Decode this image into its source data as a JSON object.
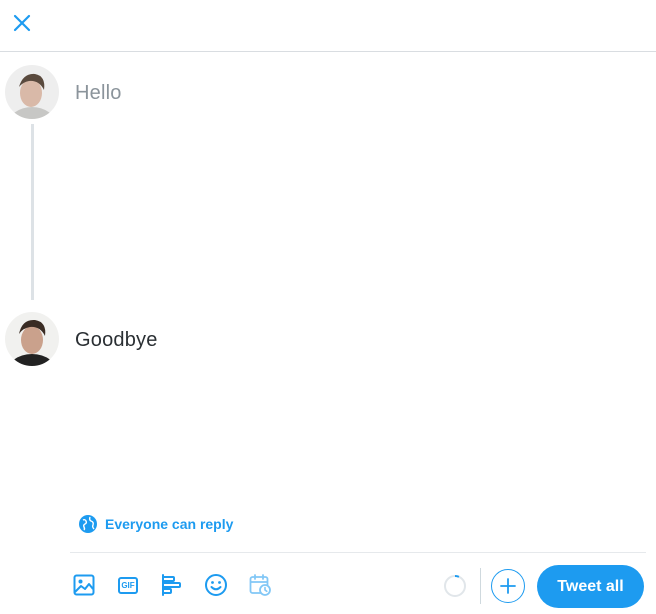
{
  "colors": {
    "accent": "#1d9bf0",
    "text_placeholder": "#8b949b",
    "text_primary": "#2a2f33"
  },
  "header": {
    "close_icon": "close-icon"
  },
  "thread": {
    "tweets": [
      {
        "text": "Hello",
        "state": "placeholder"
      },
      {
        "text": "Goodbye",
        "state": "filled"
      }
    ]
  },
  "reply_setting": {
    "icon": "globe-icon",
    "label": "Everyone can reply"
  },
  "toolbar": {
    "icons": [
      "image-icon",
      "gif-icon",
      "poll-icon",
      "emoji-icon",
      "schedule-icon"
    ],
    "gif_label": "GIF",
    "tweet_all_label": "Tweet all"
  }
}
